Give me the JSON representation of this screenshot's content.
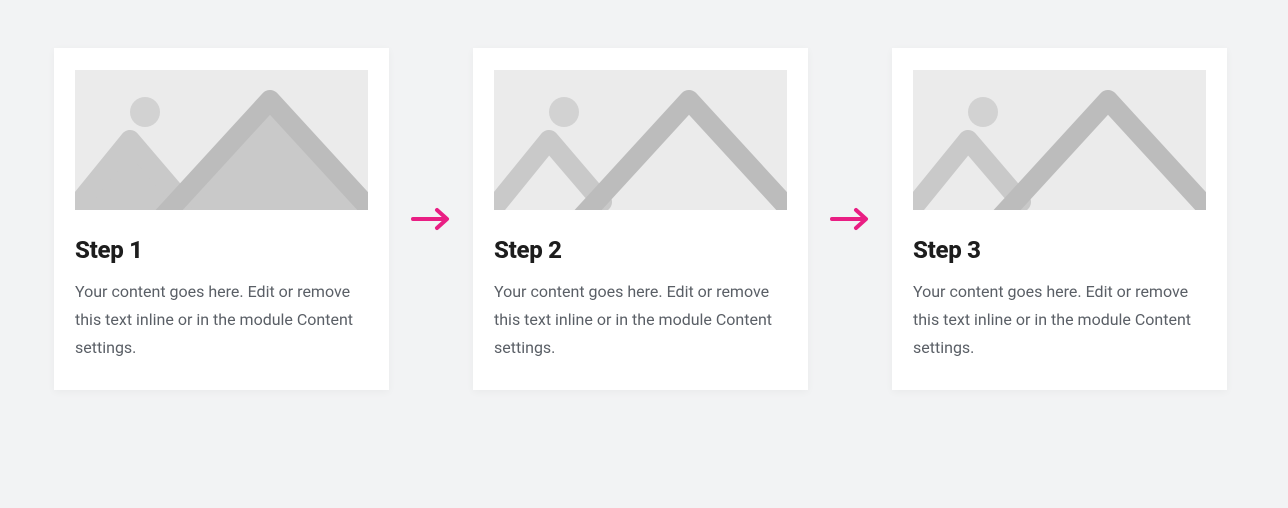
{
  "steps": [
    {
      "title": "Step 1",
      "description": "Your content goes here. Edit or remove this text inline or in the module Content settings."
    },
    {
      "title": "Step 2",
      "description": "Your content goes here. Edit or remove this text inline or in the module Content settings."
    },
    {
      "title": "Step 3",
      "description": "Your content goes here. Edit or remove this text inline or in the module Content settings."
    }
  ],
  "colors": {
    "arrow": "#e91e83"
  }
}
